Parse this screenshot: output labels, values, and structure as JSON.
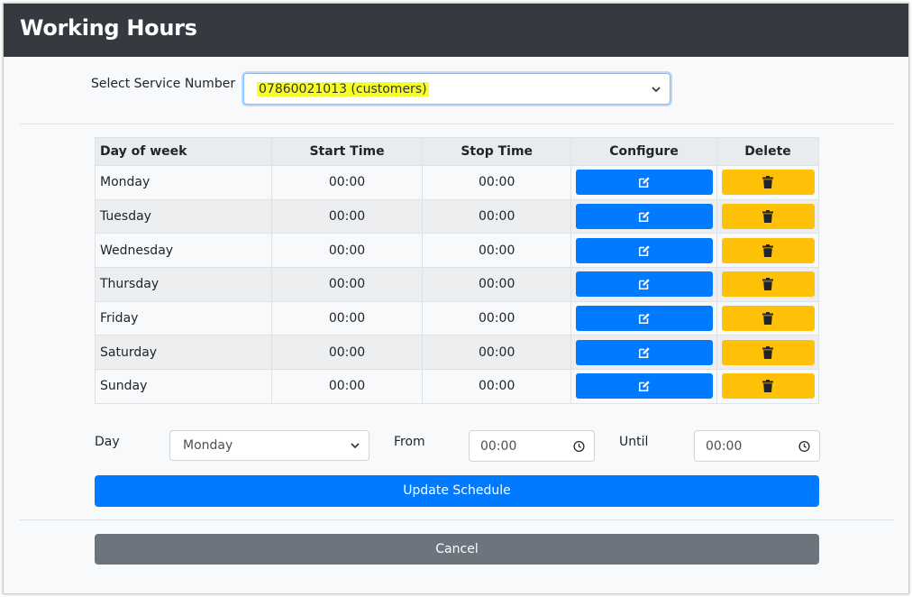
{
  "modal": {
    "title": "Working Hours"
  },
  "service": {
    "label": "Select Service Number",
    "selected": "07860021013 (customers)"
  },
  "table": {
    "headers": [
      "Day of week",
      "Start Time",
      "Stop Time",
      "Configure",
      "Delete"
    ],
    "rows": [
      {
        "day": "Monday",
        "start": "00:00",
        "stop": "00:00"
      },
      {
        "day": "Tuesday",
        "start": "00:00",
        "stop": "00:00"
      },
      {
        "day": "Wednesday",
        "start": "00:00",
        "stop": "00:00"
      },
      {
        "day": "Thursday",
        "start": "00:00",
        "stop": "00:00"
      },
      {
        "day": "Friday",
        "start": "00:00",
        "stop": "00:00"
      },
      {
        "day": "Saturday",
        "start": "00:00",
        "stop": "00:00"
      },
      {
        "day": "Sunday",
        "start": "00:00",
        "stop": "00:00"
      }
    ],
    "configure_icon": "edit-icon",
    "delete_icon": "trash-icon"
  },
  "form": {
    "day_label": "Day",
    "day_value": "Monday",
    "from_label": "From",
    "from_value": "00:00",
    "until_label": "Until",
    "until_value": "00:00",
    "update_label": "Update Schedule"
  },
  "footer": {
    "cancel_label": "Cancel"
  },
  "colors": {
    "header_bg": "#343a40",
    "primary": "#007bff",
    "warning": "#ffc107",
    "secondary": "#6c757d",
    "highlight": "#f6ff28"
  }
}
